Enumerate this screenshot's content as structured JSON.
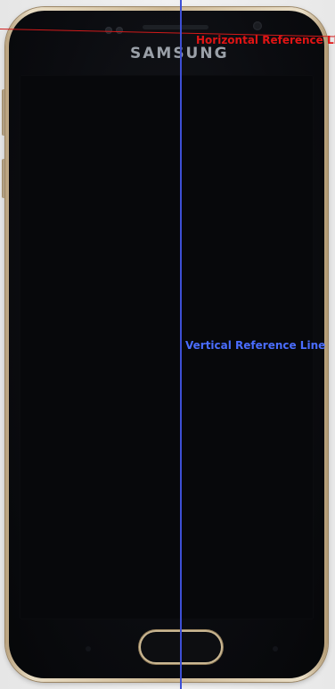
{
  "device": {
    "brand_text": "SAMSUNG"
  },
  "annotations": {
    "horizontal_label": "Horizontal Reference Line",
    "vertical_label": "Vertical Reference Line",
    "horizontal_color": "#d11a1a",
    "vertical_color": "#3d4fd6"
  },
  "colors": {
    "frame": "#cdb894",
    "glass": "#0b0c10",
    "background": "#ececec"
  }
}
